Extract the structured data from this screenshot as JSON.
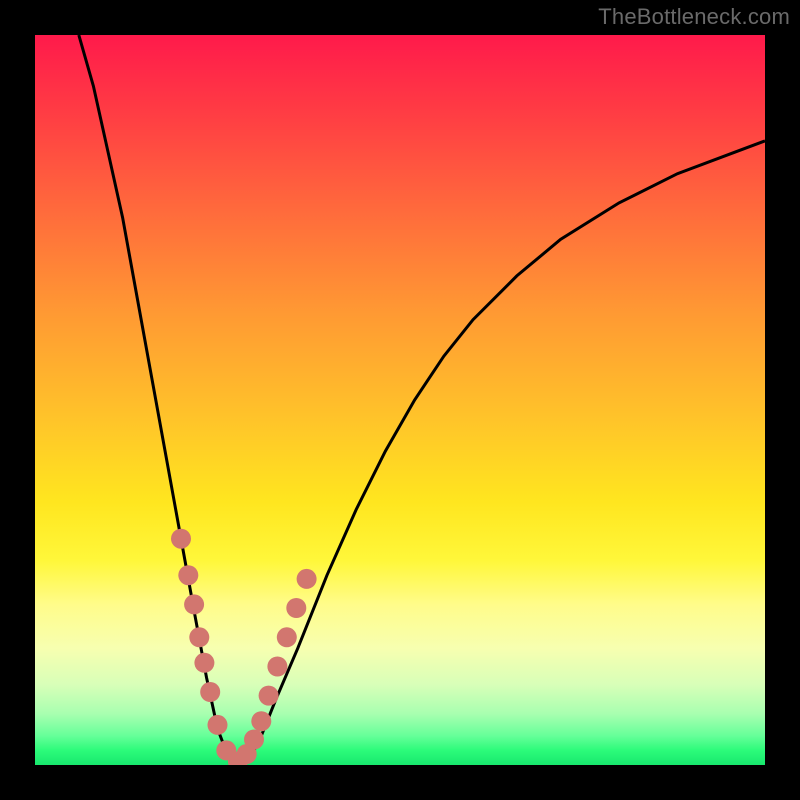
{
  "watermark": "TheBottleneck.com",
  "chart_data": {
    "type": "line",
    "title": "",
    "xlabel": "",
    "ylabel": "",
    "xlim": [
      0,
      1
    ],
    "ylim": [
      0,
      1
    ],
    "curve": {
      "name": "bottleneck-curve",
      "x": [
        0.06,
        0.08,
        0.1,
        0.12,
        0.14,
        0.16,
        0.18,
        0.2,
        0.22,
        0.235,
        0.25,
        0.265,
        0.28,
        0.295,
        0.31,
        0.33,
        0.36,
        0.4,
        0.44,
        0.48,
        0.52,
        0.56,
        0.6,
        0.66,
        0.72,
        0.8,
        0.88,
        0.96,
        1.0
      ],
      "y": [
        1.0,
        0.93,
        0.84,
        0.75,
        0.64,
        0.53,
        0.42,
        0.31,
        0.2,
        0.12,
        0.05,
        0.01,
        0.0,
        0.01,
        0.04,
        0.09,
        0.16,
        0.26,
        0.35,
        0.43,
        0.5,
        0.56,
        0.61,
        0.67,
        0.72,
        0.77,
        0.81,
        0.84,
        0.855
      ],
      "stroke": "#000000",
      "stroke_width": 3
    },
    "markers": {
      "name": "highlight-dots",
      "x": [
        0.2,
        0.21,
        0.218,
        0.225,
        0.232,
        0.24,
        0.25,
        0.262,
        0.278,
        0.29,
        0.3,
        0.31,
        0.32,
        0.332,
        0.345,
        0.358,
        0.372
      ],
      "y": [
        0.31,
        0.26,
        0.22,
        0.175,
        0.14,
        0.1,
        0.055,
        0.02,
        0.005,
        0.015,
        0.035,
        0.06,
        0.095,
        0.135,
        0.175,
        0.215,
        0.255
      ],
      "fill": "#d2766f",
      "r": 10
    },
    "background_gradient": {
      "top": "#ff1a4b",
      "bottom": "#18e86e"
    }
  }
}
